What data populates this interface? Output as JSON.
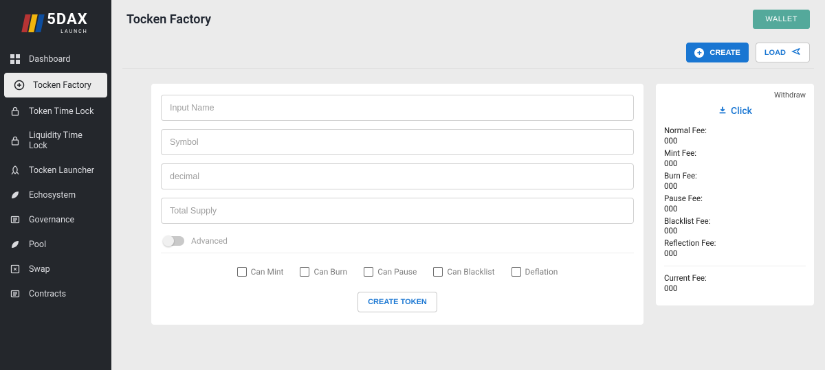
{
  "brand": {
    "name": "5DAX",
    "sub": "LAUNCH"
  },
  "sidebar": {
    "items": [
      {
        "label": "Dashboard"
      },
      {
        "label": "Tocken Factory",
        "active": true
      },
      {
        "label": "Token Time Lock"
      },
      {
        "label": "Liquidity Time Lock"
      },
      {
        "label": "Tocken Launcher"
      },
      {
        "label": "Echosystem"
      },
      {
        "label": "Governance"
      },
      {
        "label": "Pool"
      },
      {
        "label": "Swap"
      },
      {
        "label": "Contracts"
      }
    ]
  },
  "header": {
    "title": "Tocken Factory",
    "wallet_label": "WALLET",
    "create_label": "CREATE",
    "load_label": "LOAD"
  },
  "form": {
    "name_placeholder": "Input Name",
    "symbol_placeholder": "Symbol",
    "decimal_placeholder": "decimal",
    "supply_placeholder": "Total Supply",
    "advanced_label": "Advanced",
    "checks": [
      "Can Mint",
      "Can Burn",
      "Can Pause",
      "Can Blacklist",
      "Deflation"
    ],
    "create_token_label": "CREATE TOKEN"
  },
  "fees": {
    "withdraw_label": "Withdraw",
    "click_label": "Click",
    "items": [
      {
        "label": "Normal Fee:",
        "value": "000"
      },
      {
        "label": "Mint Fee:",
        "value": "000"
      },
      {
        "label": "Burn Fee:",
        "value": "000"
      },
      {
        "label": "Pause Fee:",
        "value": "000"
      },
      {
        "label": "Blacklist Fee:",
        "value": "000"
      },
      {
        "label": "Reflection Fee:",
        "value": "000"
      }
    ],
    "current_label": "Current Fee:",
    "current_value": "000"
  }
}
